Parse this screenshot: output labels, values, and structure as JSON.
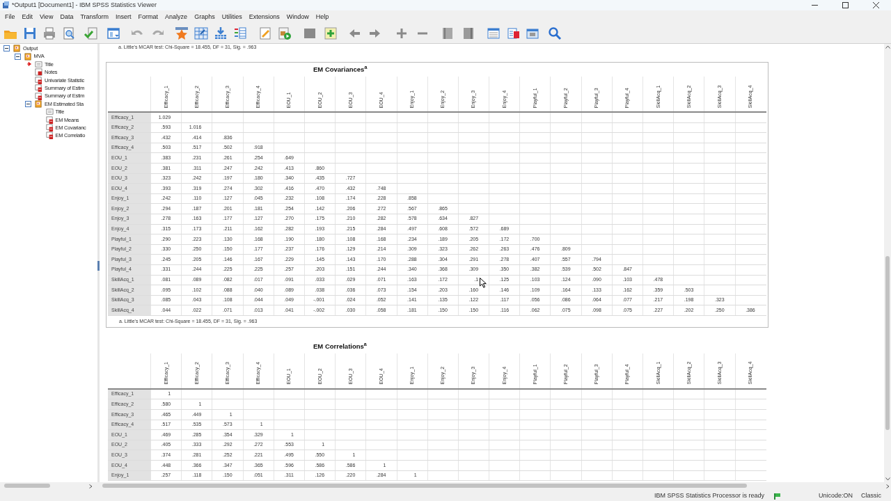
{
  "window": {
    "title": "*Output1 [Document1] - IBM SPSS Statistics Viewer"
  },
  "menu": [
    "File",
    "Edit",
    "View",
    "Data",
    "Transform",
    "Insert",
    "Format",
    "Analyze",
    "Graphs",
    "Utilities",
    "Extensions",
    "Window",
    "Help"
  ],
  "outline": [
    {
      "label": "Output",
      "kind": "folder",
      "expanded": true,
      "children": [
        {
          "label": "MVA",
          "kind": "folder",
          "expanded": true,
          "children": [
            {
              "label": "Title",
              "kind": "title",
              "current": true
            },
            {
              "label": "Notes",
              "kind": "notes",
              "current": false
            },
            {
              "label": "Univariate Statistic",
              "kind": "table",
              "current": false
            },
            {
              "label": "Summary of Estim",
              "kind": "table",
              "current": false
            },
            {
              "label": "Summary of Estim",
              "kind": "table",
              "current": false
            },
            {
              "label": "EM Estimated Sta",
              "kind": "folder",
              "expanded": true,
              "children": [
                {
                  "label": "Title",
                  "kind": "title",
                  "current": false
                },
                {
                  "label": "EM Means",
                  "kind": "table",
                  "current": false
                },
                {
                  "label": "EM Covarianc",
                  "kind": "table",
                  "current": false
                },
                {
                  "label": "EM Correlatio",
                  "kind": "table",
                  "current": false
                }
              ]
            }
          ]
        }
      ]
    }
  ],
  "top_note": "a. Little's MCAR test: Chi-Square = 18.455, DF = 31, Sig. = .963",
  "tables": [
    {
      "title": "EM Covariances$^{a}$",
      "selected": true,
      "columns": [
        "Efficacy_1",
        "Efficacy_2",
        "Efficacy_3",
        "Efficacy_4",
        "EOU_1",
        "EOU_2",
        "EOU_3",
        "EOU_4",
        "Enjoy_1",
        "Enjoy_2",
        "Enjoy_3",
        "Enjoy_4",
        "Playful_1",
        "Playful_2",
        "Playful_3",
        "Playful_4",
        "SkillAcq_1",
        "SkillAcq_2",
        "SkillAcq_3",
        "SkillAcq_4"
      ],
      "rows": [
        {
          "label": "Efficacy_1",
          "values": [
            "1.029"
          ]
        },
        {
          "label": "Efficacy_2",
          "values": [
            ".593",
            "1.016"
          ]
        },
        {
          "label": "Efficacy_3",
          "values": [
            ".432",
            ".414",
            ".836"
          ]
        },
        {
          "label": "Efficacy_4",
          "values": [
            ".503",
            ".517",
            ".502",
            ".918"
          ]
        },
        {
          "label": "EOU_1",
          "values": [
            ".383",
            ".231",
            ".261",
            ".254",
            ".649"
          ]
        },
        {
          "label": "EOU_2",
          "values": [
            ".381",
            ".311",
            ".247",
            ".242",
            ".413",
            ".860"
          ]
        },
        {
          "label": "EOU_3",
          "values": [
            ".323",
            ".242",
            ".197",
            ".180",
            ".340",
            ".435",
            ".727"
          ]
        },
        {
          "label": "EOU_4",
          "values": [
            ".393",
            ".319",
            ".274",
            ".302",
            ".416",
            ".470",
            ".432",
            ".748"
          ]
        },
        {
          "label": "Enjoy_1",
          "values": [
            ".242",
            ".110",
            ".127",
            ".045",
            ".232",
            ".108",
            ".174",
            ".228",
            ".858"
          ]
        },
        {
          "label": "Enjoy_2",
          "values": [
            ".294",
            ".187",
            ".201",
            ".181",
            ".254",
            ".142",
            ".206",
            ".272",
            ".567",
            ".865"
          ]
        },
        {
          "label": "Enjoy_3",
          "values": [
            ".278",
            ".163",
            ".177",
            ".127",
            ".270",
            ".175",
            ".210",
            ".282",
            ".578",
            ".634",
            ".827"
          ]
        },
        {
          "label": "Enjoy_4",
          "values": [
            ".315",
            ".173",
            ".211",
            ".162",
            ".282",
            ".193",
            ".215",
            ".284",
            ".497",
            ".608",
            ".572",
            ".689"
          ]
        },
        {
          "label": "Playful_1",
          "values": [
            ".290",
            ".223",
            ".130",
            ".168",
            ".190",
            ".180",
            ".108",
            ".168",
            ".234",
            ".189",
            ".205",
            ".172",
            ".700"
          ]
        },
        {
          "label": "Playful_2",
          "values": [
            ".330",
            ".250",
            ".150",
            ".177",
            ".237",
            ".176",
            ".129",
            ".214",
            ".309",
            ".323",
            ".262",
            ".263",
            ".476",
            ".809"
          ]
        },
        {
          "label": "Playful_3",
          "values": [
            ".245",
            ".205",
            ".146",
            ".167",
            ".229",
            ".145",
            ".143",
            ".170",
            ".288",
            ".304",
            ".291",
            ".278",
            ".407",
            ".557",
            ".794"
          ]
        },
        {
          "label": "Playful_4",
          "values": [
            ".331",
            ".244",
            ".225",
            ".225",
            ".257",
            ".203",
            ".151",
            ".244",
            ".340",
            ".368",
            ".309",
            ".350",
            ".382",
            ".539",
            ".502",
            ".847"
          ]
        },
        {
          "label": "SkillAcq_1",
          "values": [
            ".081",
            ".089",
            ".082",
            ".017",
            ".091",
            ".033",
            ".029",
            ".071",
            ".163",
            ".172",
            ".1",
            ".125",
            ".103",
            ".124",
            ".090",
            ".103",
            ".478"
          ]
        },
        {
          "label": "SkillAcq_2",
          "values": [
            ".095",
            ".102",
            ".088",
            ".040",
            ".089",
            ".038",
            ".036",
            ".073",
            ".154",
            ".203",
            ".160",
            ".146",
            ".109",
            ".164",
            ".133",
            ".162",
            ".359",
            ".503"
          ]
        },
        {
          "label": "SkillAcq_3",
          "values": [
            ".085",
            ".043",
            ".108",
            ".044",
            ".049",
            "-.001",
            ".024",
            ".052",
            ".141",
            ".135",
            ".122",
            ".117",
            ".056",
            ".086",
            ".064",
            ".077",
            ".217",
            ".198",
            ".323"
          ]
        },
        {
          "label": "SkillAcq_4",
          "values": [
            ".044",
            ".022",
            ".071",
            ".013",
            ".041",
            "-.002",
            ".030",
            ".058",
            ".181",
            ".150",
            ".150",
            ".116",
            ".062",
            ".075",
            ".098",
            ".075",
            ".227",
            ".202",
            ".250",
            ".386"
          ]
        }
      ],
      "footnote": "a. Little's MCAR test: Chi-Square = 18.455, DF = 31, Sig. = .963"
    },
    {
      "title": "EM Correlations$^{a}$",
      "selected": false,
      "columns": [
        "Efficacy_1",
        "Efficacy_2",
        "Efficacy_3",
        "Efficacy_4",
        "EOU_1",
        "EOU_2",
        "EOU_3",
        "EOU_4",
        "Enjoy_1",
        "Enjoy_2",
        "Enjoy_3",
        "Enjoy_4",
        "Playful_1",
        "Playful_2",
        "Playful_3",
        "Playful_4",
        "SkillAcq_1",
        "SkillAcq_2",
        "SkillAcq_3",
        "SkillAcq_4"
      ],
      "rows": [
        {
          "label": "Efficacy_1",
          "values": [
            "1"
          ]
        },
        {
          "label": "Efficacy_2",
          "values": [
            ".580",
            "1"
          ]
        },
        {
          "label": "Efficacy_3",
          "values": [
            ".465",
            ".449",
            "1"
          ]
        },
        {
          "label": "Efficacy_4",
          "values": [
            ".517",
            ".535",
            ".573",
            "1"
          ]
        },
        {
          "label": "EOU_1",
          "values": [
            ".469",
            ".285",
            ".354",
            ".329",
            "1"
          ]
        },
        {
          "label": "EOU_2",
          "values": [
            ".405",
            ".333",
            ".292",
            ".272",
            ".553",
            "1"
          ]
        },
        {
          "label": "EOU_3",
          "values": [
            ".374",
            ".281",
            ".252",
            ".221",
            ".495",
            ".550",
            "1"
          ]
        },
        {
          "label": "EOU_4",
          "values": [
            ".448",
            ".366",
            ".347",
            ".365",
            ".596",
            ".586",
            ".586",
            "1"
          ]
        },
        {
          "label": "Enjoy_1",
          "values": [
            ".257",
            ".118",
            ".150",
            ".051",
            ".311",
            ".126",
            ".220",
            ".284",
            "1"
          ]
        }
      ]
    }
  ],
  "status_bar": {
    "message": "IBM SPSS Statistics Processor is ready",
    "encoding": "Unicode:ON",
    "mode": "Classic"
  }
}
